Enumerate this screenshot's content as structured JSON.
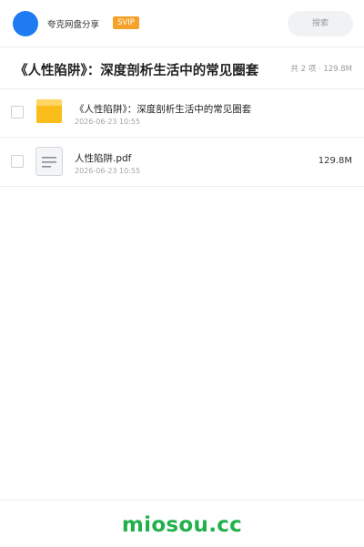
{
  "header": {
    "brand": "夸克网盘分享",
    "badge": "SVIP",
    "search_placeholder": "搜索",
    "avatar_color": "#1e7bf2",
    "badge_color": "#f5a12a"
  },
  "folder": {
    "title": "《人性陷阱》：深度剖析生活中的常见圈套",
    "summary": "共 2 项 · 129.8M"
  },
  "files": [
    {
      "name": "《人性陷阱》：深度剖析生活中的常见圈套",
      "date": "2026-06-23 10:55",
      "size": "",
      "icon": "folder-icon"
    },
    {
      "name": "人性陷阱.pdf",
      "date": "2026-06-23 10:55",
      "size": "129.8M",
      "icon": "document-icon"
    }
  ],
  "footer": {
    "watermark": "miosou.cc",
    "watermark_color": "#22b04b"
  }
}
